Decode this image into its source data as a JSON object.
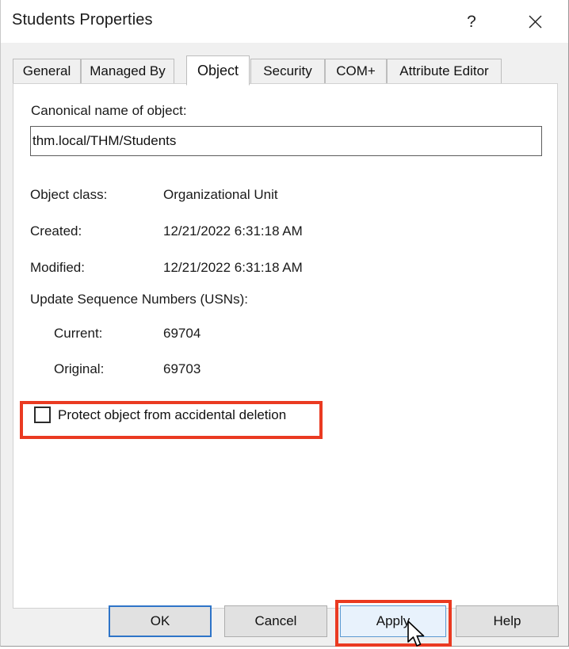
{
  "window": {
    "title": "Students Properties",
    "help_button": "?",
    "close_button": "✕"
  },
  "tabs": [
    {
      "label": "General",
      "active": false
    },
    {
      "label": "Managed By",
      "active": false
    },
    {
      "label": "Object",
      "active": true
    },
    {
      "label": "Security",
      "active": false
    },
    {
      "label": "COM+",
      "active": false
    },
    {
      "label": "Attribute Editor",
      "active": false
    }
  ],
  "object_tab": {
    "canonical_name_label": "Canonical name of object:",
    "canonical_name_value": "thm.local/THM/Students",
    "canonical_name_placeholder": "",
    "rows": [
      {
        "label": "Object class:",
        "value": "Organizational Unit"
      },
      {
        "label": "Created:",
        "value": "12/21/2022 6:31:18 AM"
      },
      {
        "label": "Modified:",
        "value": "12/21/2022 6:31:18 AM"
      }
    ],
    "usn_heading": "Update Sequence Numbers (USNs):",
    "usn_rows": [
      {
        "label": "Current:",
        "value": "69704"
      },
      {
        "label": "Original:",
        "value": "69703"
      }
    ],
    "protect_checkbox": {
      "label": "Protect object from accidental deletion",
      "checked": false
    }
  },
  "footer": {
    "ok_label": "OK",
    "cancel_label": "Cancel",
    "apply_label": "Apply",
    "help_label": "Help"
  },
  "annotations": {
    "color": "#ea3a21",
    "highlighted": [
      "protect-from-deletion-checkbox",
      "apply-button"
    ]
  }
}
